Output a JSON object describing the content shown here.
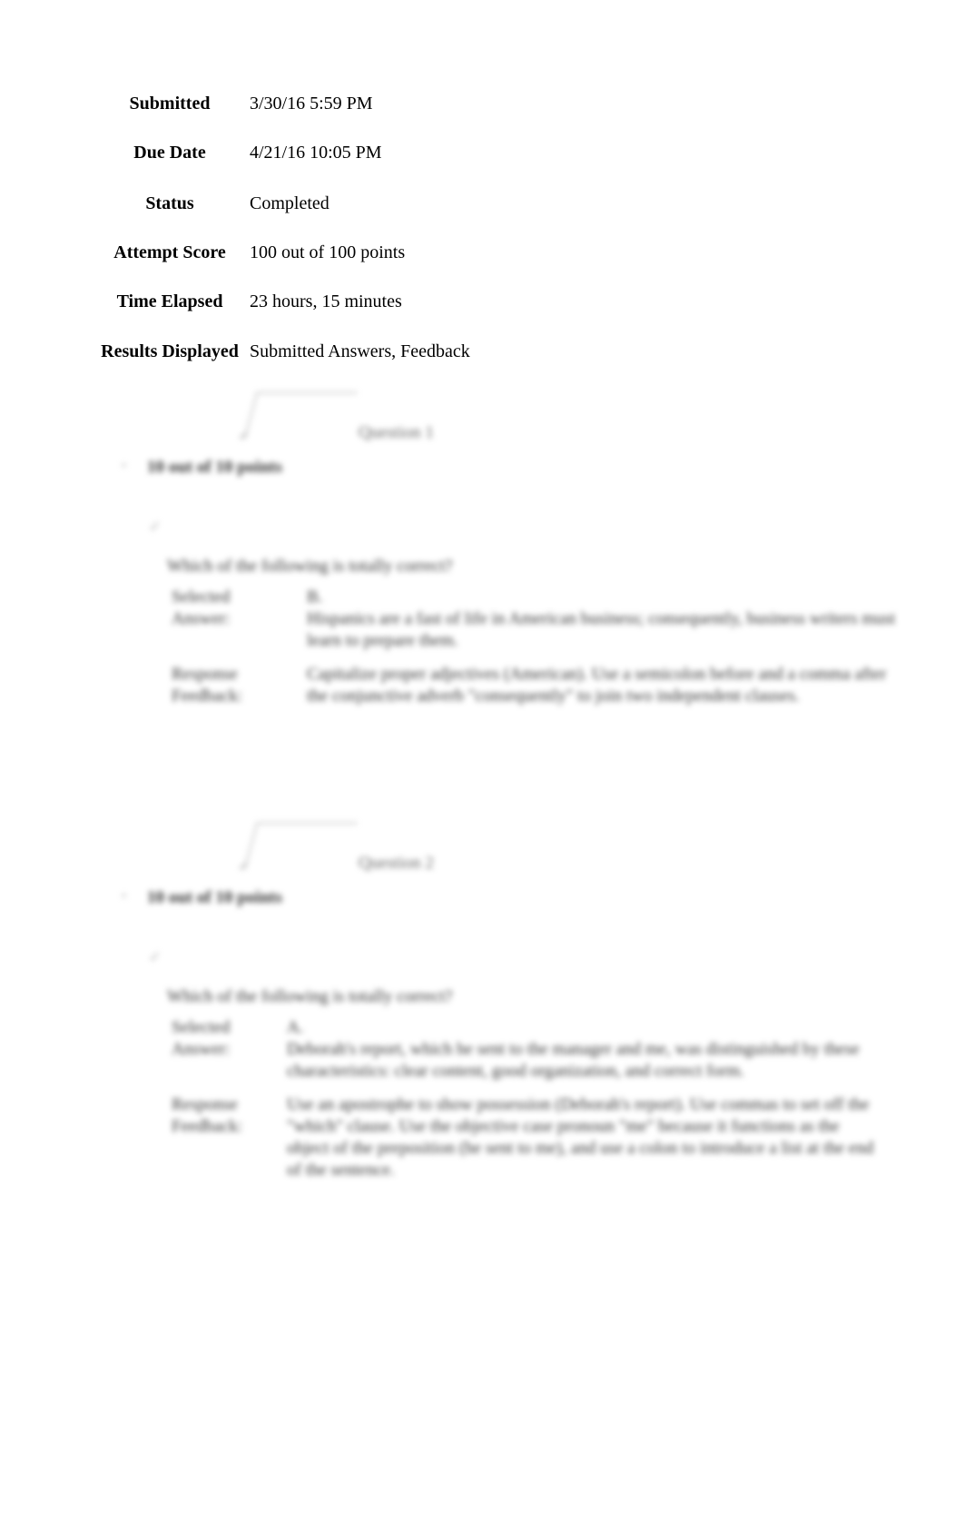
{
  "attempt_info": [
    {
      "label": "Submitted",
      "value": "3/30/16 5:59 PM"
    },
    {
      "label": "Due Date",
      "value": "4/21/16 10:05 PM"
    },
    {
      "label": "Status",
      "value": "Completed"
    },
    {
      "label": "Attempt Score",
      "value": "100 out of 100 points"
    },
    {
      "label": "Time Elapsed",
      "value": "23 hours, 15 minutes"
    },
    {
      "label": "Results Displayed",
      "value": "Submitted Answers, Feedback"
    }
  ],
  "questions": [
    {
      "title": "Question 1",
      "points": "10 out of 10 points",
      "prompt": "Which of the following is totally correct?",
      "selected_label": "Selected Answer:",
      "selected_letter": "B.",
      "selected_text": [
        "Hispanics are a fast of life in American business; consequently, business writers must",
        "learn to prepare them."
      ],
      "feedback_label": "Response Feedback:",
      "feedback_text": [
        "Capitalize proper adjectives (American). Use a semicolon before and a comma after",
        "the conjunctive adverb \"consequently\" to join two independent clauses."
      ]
    },
    {
      "title": "Question 2",
      "points": "10 out of 10 points",
      "prompt": "Which of the following is totally correct?",
      "selected_label": "Selected Answer:",
      "selected_letter": "A.",
      "selected_text": [
        "Deborah's report, which he sent to the manager and me, was distinguished by these",
        "characteristics: clear content, good organization, and correct form."
      ],
      "feedback_label": "Response Feedback:",
      "feedback_text": [
        "Use an apostrophe to show possession (Deborah's report). Use commas to set off the",
        "\"which\" clause. Use the objective case pronoun \"me\" because it functions as the",
        "object of the preposition (he sent to me), and use a colon to introduce a list at the end",
        "of the sentence."
      ]
    }
  ]
}
